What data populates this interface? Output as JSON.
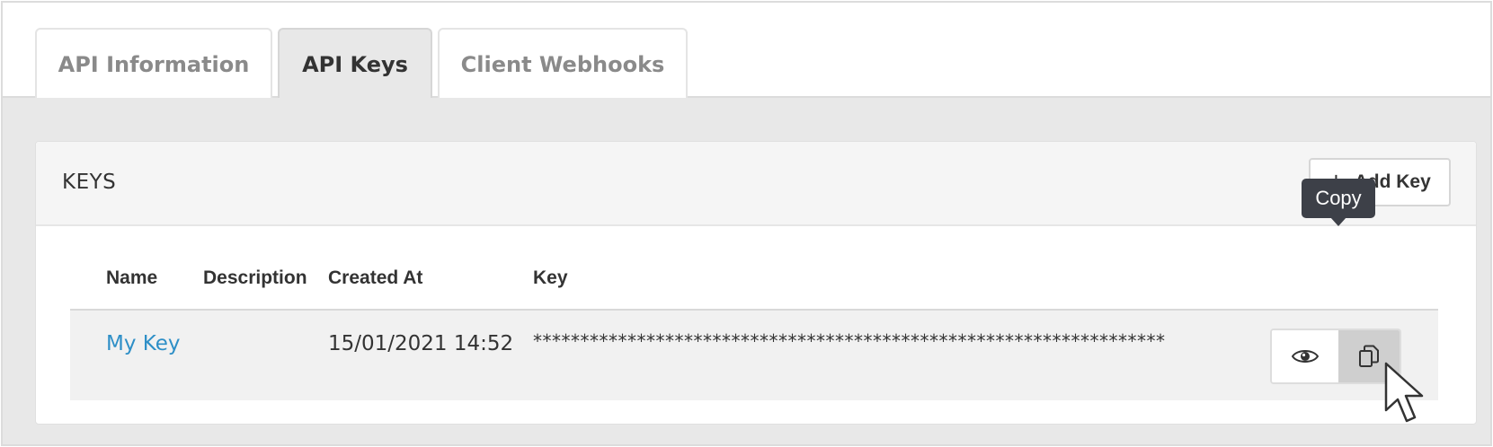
{
  "tabs": [
    {
      "label": "API Information",
      "active": false
    },
    {
      "label": "API Keys",
      "active": true
    },
    {
      "label": "Client Webhooks",
      "active": false
    }
  ],
  "keys_panel": {
    "title": "KEYS",
    "add_button_label": "Add Key",
    "add_button_icon": "plus-icon"
  },
  "table": {
    "columns": [
      "Name",
      "Description",
      "Created At",
      "Key"
    ],
    "rows": [
      {
        "name": "My Key",
        "description": "",
        "created_at": "15/01/2021 14:52",
        "key": "*******************************************************************"
      }
    ]
  },
  "row_actions": {
    "view_icon": "eye-icon",
    "copy_icon": "copy-icon"
  },
  "tooltip": {
    "text": "Copy"
  },
  "colors": {
    "link": "#2e8fc7",
    "tooltip_bg": "#3d4048",
    "active_tab_bg": "#e8e8e8",
    "content_bg": "#e8e8e8"
  }
}
